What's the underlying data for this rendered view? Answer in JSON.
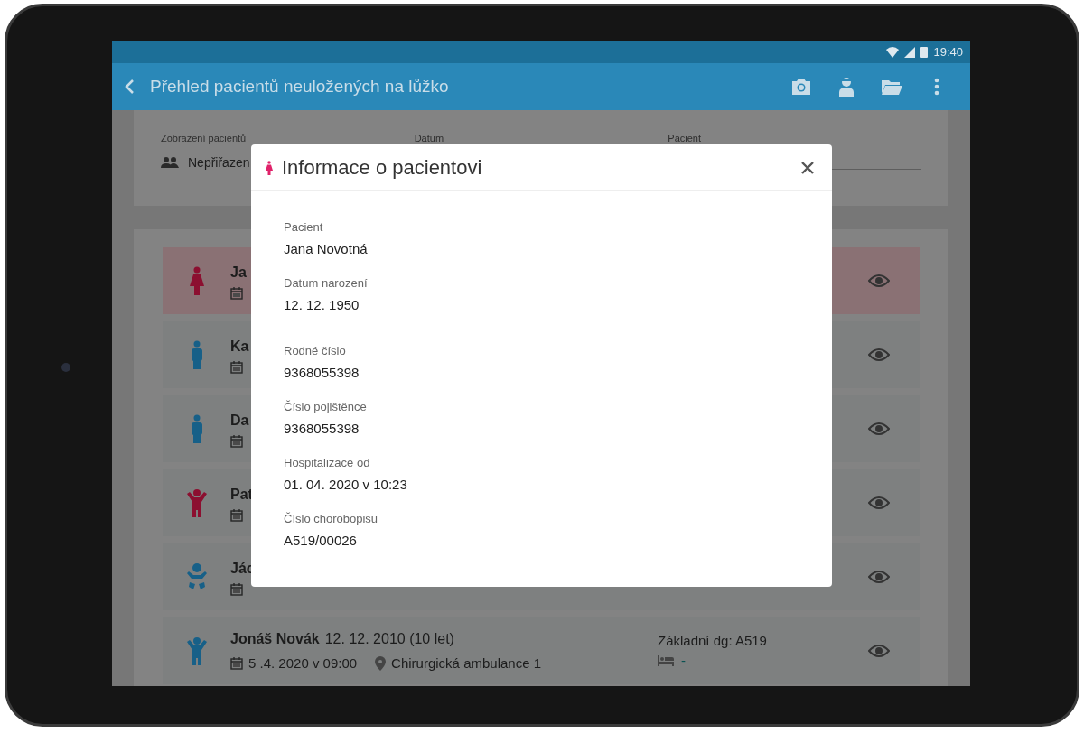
{
  "status_bar": {
    "time": "19:40"
  },
  "app_bar": {
    "title": "Přehled pacientů neuložených na lůžko"
  },
  "filters": [
    {
      "label": "Zobrazení pacientů",
      "value": "Nepřiřazen"
    },
    {
      "label": "Datum"
    },
    {
      "label": "Pacient"
    }
  ],
  "patients": [
    {
      "kind": "woman",
      "color": "#8c0f30",
      "selected": true,
      "name": "Ja"
    },
    {
      "kind": "man",
      "color": "#176088",
      "selected": false,
      "name": "Ka"
    },
    {
      "kind": "man",
      "color": "#176088",
      "selected": false,
      "name": "Da"
    },
    {
      "kind": "child",
      "color": "#8c0f30",
      "selected": false,
      "name": "Pat"
    },
    {
      "kind": "baby",
      "color": "#176088",
      "selected": false,
      "name": "Jác"
    },
    {
      "kind": "child",
      "color": "#176088",
      "selected": false,
      "name": "Jonáš Novák",
      "birth": "12. 12. 2010 (10 let)",
      "date": "5 .4. 2020 v 09:00",
      "place": "Chirurgická ambulance 1",
      "diagnosis": "Základní dg: A519",
      "bed": "-"
    }
  ],
  "dialog": {
    "title": "Informace o pacientovi",
    "fields": [
      {
        "label": "Pacient",
        "value": "Jana Novotná"
      },
      {
        "label": "Datum narození",
        "value": "12. 12. 1950"
      },
      {
        "label": "Rodné číslo",
        "value": "9368055398"
      },
      {
        "label": "Číslo pojištěnce",
        "value": "9368055398"
      },
      {
        "label": "Hospitalizace od",
        "value": "01. 04. 2020 v 10:23"
      },
      {
        "label": "Číslo chorobopisu",
        "value": "A519/00026"
      }
    ]
  }
}
